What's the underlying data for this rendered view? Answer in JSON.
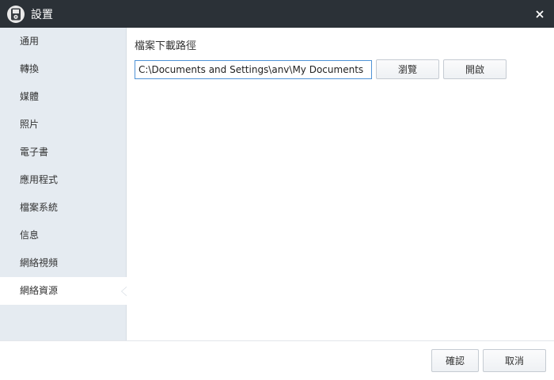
{
  "window": {
    "title": "設置"
  },
  "sidebar": {
    "items": [
      {
        "label": "通用"
      },
      {
        "label": "轉換"
      },
      {
        "label": "媒體"
      },
      {
        "label": "照片"
      },
      {
        "label": "電子書"
      },
      {
        "label": "應用程式"
      },
      {
        "label": "檔案系統"
      },
      {
        "label": "信息"
      },
      {
        "label": "網絡視頻"
      },
      {
        "label": "網絡資源"
      }
    ],
    "active_index": 9
  },
  "main": {
    "section_title": "檔案下載路徑",
    "path_value": "C:\\Documents and Settings\\anv\\My Documents",
    "browse_label": "瀏覽",
    "open_label": "開啟"
  },
  "footer": {
    "ok_label": "確認",
    "cancel_label": "取消"
  },
  "icons": {
    "app": "ipod-icon",
    "close": "close-icon"
  }
}
